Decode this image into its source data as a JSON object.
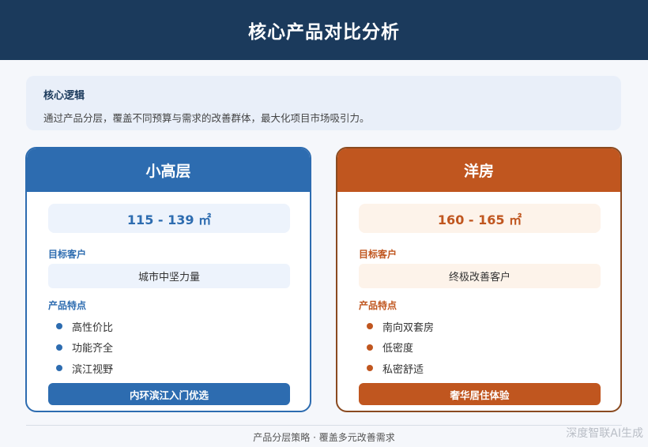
{
  "header": {
    "title": "核心产品对比分析"
  },
  "logic": {
    "title": "核心逻辑",
    "text": "通过产品分层，覆盖不同预算与需求的改善群体，最大化项目市场吸引力。"
  },
  "cards": [
    {
      "title": "小高层",
      "area": "115 - 139 ㎡",
      "target_label": "目标客户",
      "target": "城市中坚力量",
      "features_label": "产品特点",
      "features": [
        "高性价比",
        "功能齐全",
        "滨江视野"
      ],
      "cta": "内环滨江入门优选",
      "accent": "#2d6cb0"
    },
    {
      "title": "洋房",
      "area": "160 - 165 ㎡",
      "target_label": "目标客户",
      "target": "终极改善客户",
      "features_label": "产品特点",
      "features": [
        "南向双套房",
        "低密度",
        "私密舒适"
      ],
      "cta": "奢华居住体验",
      "accent": "#c0561f"
    }
  ],
  "footer": {
    "text": "产品分层策略 · 覆盖多元改善需求"
  },
  "watermark": "深度智联AI生成",
  "colors": {
    "header_bg": "#1b3a5c",
    "blue": "#2d6cb0",
    "orange": "#c0561f"
  }
}
